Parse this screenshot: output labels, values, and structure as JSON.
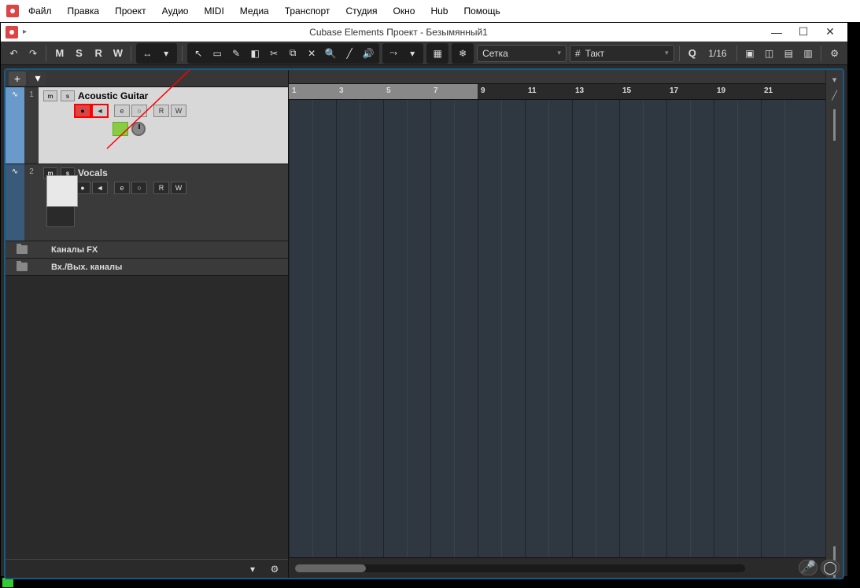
{
  "menubar": {
    "items": [
      "Файл",
      "Правка",
      "Проект",
      "Аудио",
      "MIDI",
      "Медиа",
      "Транспорт",
      "Студия",
      "Окно",
      "Hub",
      "Помощь"
    ]
  },
  "titlebar": {
    "title": "Cubase Elements Проект - Безымянный1"
  },
  "toolbar": {
    "letters": [
      "M",
      "S",
      "R",
      "W"
    ],
    "snap_label": "Сетка",
    "quantize_label": "Такт",
    "q_label": "Q",
    "grid_value": "1/16"
  },
  "ruler": {
    "numbers": [
      "1",
      "3",
      "5",
      "7",
      "9",
      "11",
      "13",
      "15",
      "17",
      "19",
      "21"
    ]
  },
  "tracks": [
    {
      "num": "1",
      "name": "Acoustic Guitar",
      "selected": true,
      "ms": [
        "m",
        "s"
      ],
      "ctrl_rec": "●",
      "ctrl_mon": "◄",
      "ctrl_e": "e",
      "ctrl_o": "○",
      "ctrl_r": "R",
      "ctrl_w": "W"
    },
    {
      "num": "2",
      "name": "Vocals",
      "selected": false,
      "ms": [
        "m",
        "s"
      ],
      "ctrl_rec": "●",
      "ctrl_mon": "◄",
      "ctrl_e": "e",
      "ctrl_o": "○",
      "ctrl_r": "R",
      "ctrl_w": "W"
    }
  ],
  "folders": [
    {
      "label": "Каналы FX"
    },
    {
      "label": "Вх./Вых. каналы"
    }
  ],
  "icons": {
    "undo": "↶",
    "redo": "↷",
    "arrow": "▸",
    "dd": "▾",
    "pointer": "↖",
    "range": "▭",
    "pencil": "✎",
    "eraser": "◧",
    "scissors": "✂",
    "glue": "⧉",
    "mute": "✕",
    "zoom": "🔍",
    "line": "╱",
    "play": "🔊",
    "warp": "⤳",
    "color": "▦",
    "snap": "❄",
    "hash": "#",
    "layout1": "▣",
    "layout2": "◫",
    "layout3": "▤",
    "layout4": "▥",
    "gear": "⚙",
    "plus": "+",
    "menu": "▾",
    "mic": "🎤",
    "circle": "◯",
    "min": "—",
    "max": "☐",
    "close": "✕"
  }
}
